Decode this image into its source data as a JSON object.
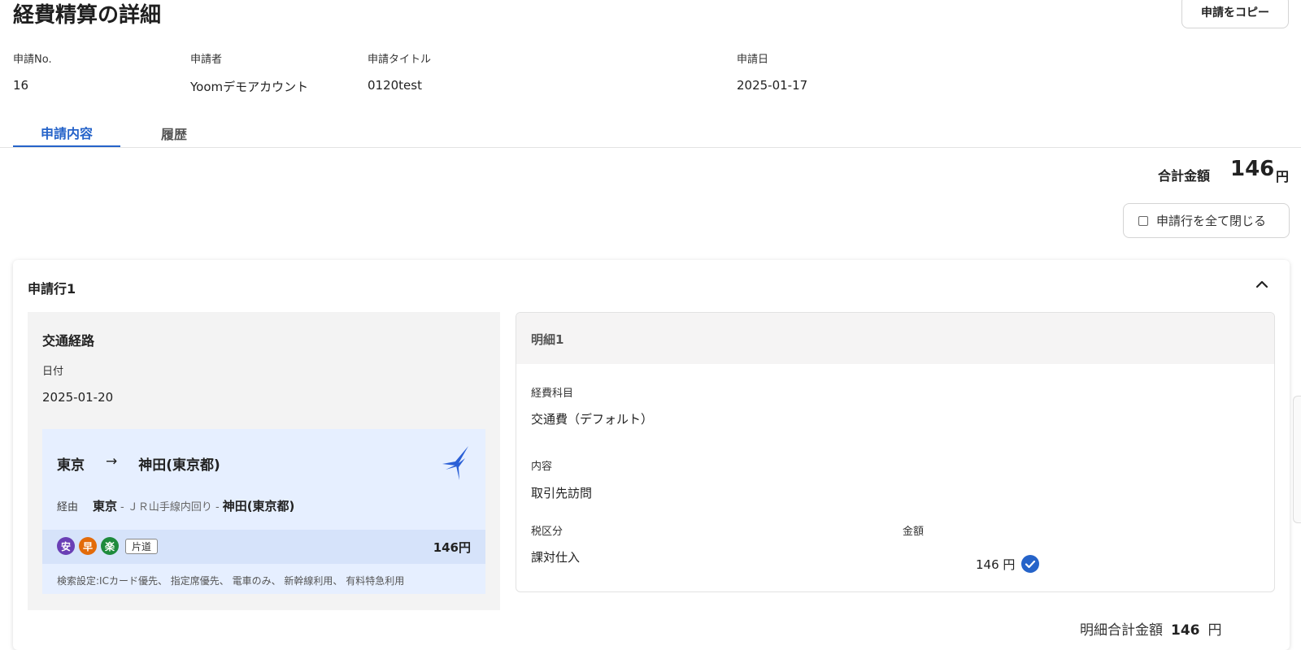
{
  "page": {
    "title": "経費精算の詳細",
    "copy_button_label": "申請をコピー"
  },
  "meta": {
    "fields": [
      {
        "label": "申請No.",
        "value": "16"
      },
      {
        "label": "申請者",
        "value": "Yoomデモアカウント"
      },
      {
        "label": "申請タイトル",
        "value": "0120test"
      },
      {
        "label": "申請日",
        "value": "2025-01-17"
      }
    ]
  },
  "tabs": [
    {
      "label": "申請内容",
      "active": true
    },
    {
      "label": "履歴",
      "active": false
    }
  ],
  "summary": {
    "total_label": "合計金額",
    "total_value": "146",
    "total_unit": "円",
    "collapse_all_label": "申請行を全て閉じる"
  },
  "line": {
    "title": "申請行1",
    "route": {
      "section_title": "交通経路",
      "date_label": "日付",
      "date_value": "2025-01-20",
      "from": "東京",
      "arrow": "→",
      "to": "神田(東京都)",
      "via_label": "経由",
      "via_from": "東京",
      "via_line": "- ＪＲ山手線内回り -",
      "via_to": "神田(東京都)",
      "badges": [
        "安",
        "早",
        "楽"
      ],
      "trip_type": "片道",
      "fare": "146円",
      "search_settings": "検索設定:ICカード優先、 指定席優先、 電車のみ、 新幹線利用、 有料特急利用"
    },
    "detail": {
      "title": "明細1",
      "expense_category_label": "経費科目",
      "expense_category_value": "交通費（デフォルト）",
      "content_label": "内容",
      "content_value": "取引先訪問",
      "tax_label": "税区分",
      "tax_value": "課対仕入",
      "amount_label": "金額",
      "amount_value": "146 円"
    },
    "subtotal_label": "明細合計金額",
    "subtotal_value": "146",
    "subtotal_unit": "円"
  },
  "colors": {
    "accent": "#2563c9",
    "badge_cheap": "#6a3fb5",
    "badge_fast": "#e36b0a",
    "badge_easy": "#1e8b3c",
    "route_box_bg": "#e6efff"
  },
  "icons": {
    "logo": "bird-logo-icon",
    "collapse": "chevron-up-icon",
    "verified": "check-circle-icon"
  }
}
